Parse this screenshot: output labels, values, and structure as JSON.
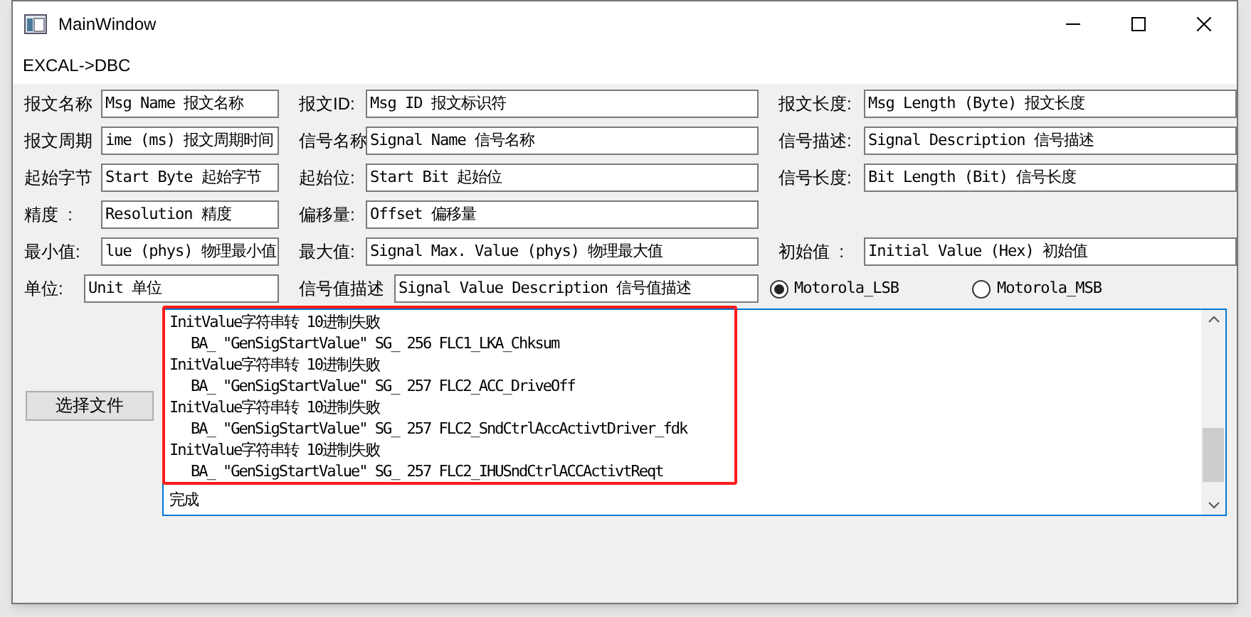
{
  "window": {
    "title": "MainWindow"
  },
  "menu_bar": [
    "EXCAL->DBC"
  ],
  "form_rows": [
    {
      "fields": [
        {
          "label": "报文名称",
          "value": "Msg Name 报文名称"
        },
        {
          "label": "报文ID:",
          "value": "Msg ID 报文标识符"
        },
        {
          "label": "报文长度:",
          "value": "Msg Length (Byte) 报文长度"
        }
      ]
    },
    {
      "fields": [
        {
          "label": "报文周期",
          "value": "ime (ms) 报文周期时间"
        },
        {
          "label": "信号名称",
          "value": "Signal Name 信号名称"
        },
        {
          "label": "信号描述:",
          "value": "Signal Description 信号描述"
        }
      ]
    },
    {
      "fields": [
        {
          "label": "起始字节",
          "value": "Start Byte 起始字节"
        },
        {
          "label": "起始位:",
          "value": "Start Bit 起始位"
        },
        {
          "label": "信号长度:",
          "value": "Bit Length (Bit) 信号长度"
        }
      ]
    },
    {
      "fields": [
        {
          "label": "精度  :",
          "value": "Resolution 精度"
        },
        {
          "label": "偏移量:",
          "value": "Offset 偏移量"
        }
      ]
    },
    {
      "fields": [
        {
          "label": "最小值:",
          "value": "lue (phys) 物理最小值"
        },
        {
          "label": "最大值:",
          "value": "Signal Max. Value (phys) 物理最大值"
        },
        {
          "label": "初始值  :",
          "value": "Initial Value (Hex) 初始值"
        }
      ]
    },
    {
      "fields": [
        {
          "label": "单位:",
          "value": "Unit 单位"
        },
        {
          "label": "信号值描述",
          "value": "Signal Value Description 信号值描述"
        }
      ],
      "radios": [
        {
          "label": "Motorola_LSB",
          "selected": true
        },
        {
          "label": "Motorola_MSB",
          "selected": false
        }
      ]
    }
  ],
  "choose_file_button": "选择文件",
  "log": [
    {
      "kind": "status",
      "text": "InitValue字符串转 10进制失败"
    },
    {
      "kind": "detail",
      "text": "BA_ \"GenSigStartValue\" SG_ 256 FLC1_LKA_Chksum"
    },
    {
      "kind": "status",
      "text": "InitValue字符串转 10进制失败"
    },
    {
      "kind": "detail",
      "text": "BA_ \"GenSigStartValue\" SG_ 257 FLC2_ACC_DriveOff"
    },
    {
      "kind": "status",
      "text": "InitValue字符串转 10进制失败"
    },
    {
      "kind": "detail",
      "text": "BA_ \"GenSigStartValue\" SG_ 257 FLC2_SndCtrlAccActivtDriver_fdk"
    },
    {
      "kind": "status",
      "text": "InitValue字符串转 10进制失败"
    },
    {
      "kind": "detail",
      "text": "BA_ \"GenSigStartValue\" SG_ 257 FLC2_IHUSndCtrlACCActivtReqt"
    },
    {
      "kind": "status",
      "text": "完成"
    }
  ]
}
